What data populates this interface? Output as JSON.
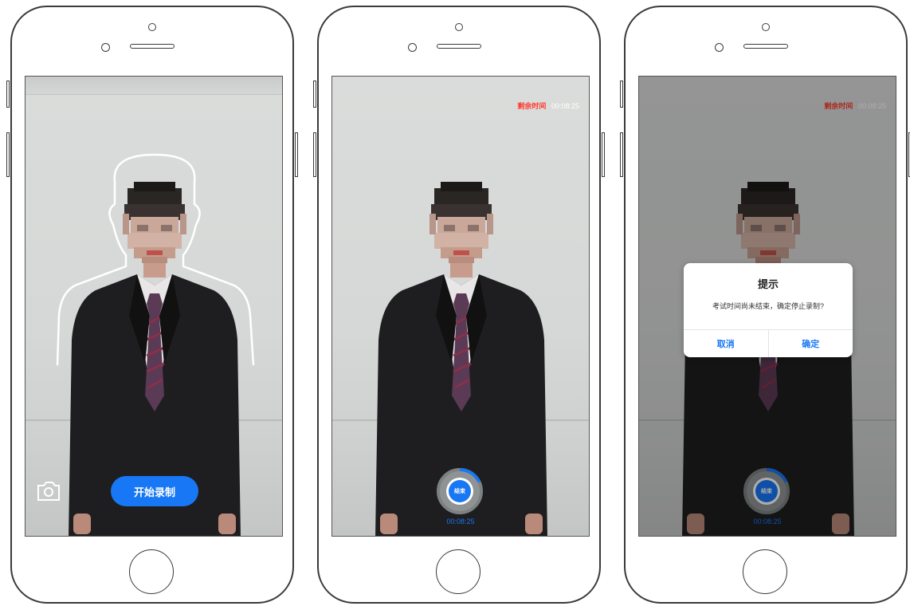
{
  "screens": [
    {
      "id": "guide",
      "start_button_label": "开始录制",
      "switch_camera_icon": "camera-switch-icon"
    },
    {
      "id": "recording",
      "timer": {
        "label": "剩余时间",
        "value": "00:08:25"
      },
      "stop_button_label": "结束",
      "elapsed": "00:08:25",
      "progress": 0.18
    },
    {
      "id": "confirm",
      "timer": {
        "label": "剩余时间",
        "value": "00:08:25"
      },
      "stop_button_label": "结束",
      "elapsed": "00:08:25",
      "progress": 0.18,
      "dialog": {
        "title": "提示",
        "message": "考试时间尚未结束，确定停止录制?",
        "cancel_label": "取消",
        "confirm_label": "确定"
      }
    }
  ],
  "colors": {
    "accent": "#1777f5",
    "timer_label": "#ff3b2f",
    "phone_outline": "#3a3a3a"
  }
}
